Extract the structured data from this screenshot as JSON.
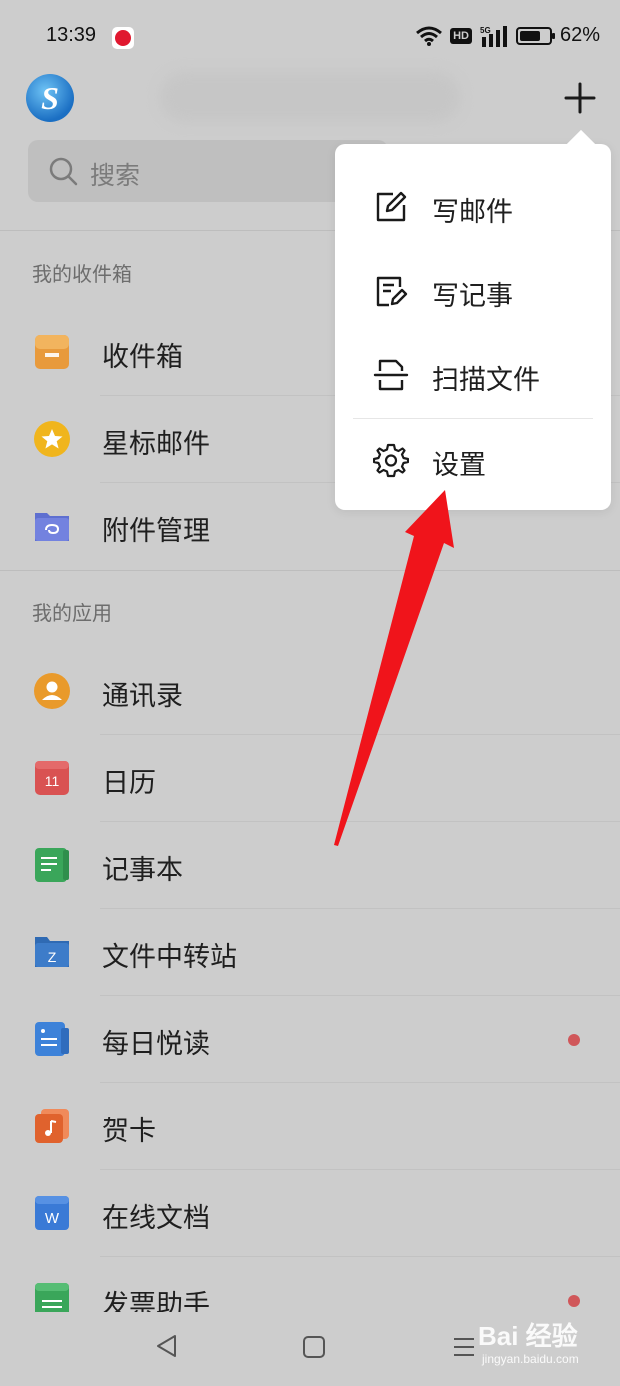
{
  "status_bar": {
    "time": "13:39",
    "hd_label": "HD",
    "network_label": "5G",
    "battery_percent": "62%",
    "battery_level": 0.62
  },
  "header": {
    "logo_letter": "S",
    "search_placeholder": "搜索"
  },
  "sections": {
    "mailbox_title": "我的收件箱",
    "apps_title": "我的应用"
  },
  "mailbox_items": [
    {
      "label": "收件箱",
      "icon": "inbox-tray-icon",
      "color": "#e89a3c"
    },
    {
      "label": "星标邮件",
      "icon": "star-icon",
      "color": "#f0b51d"
    },
    {
      "label": "附件管理",
      "icon": "attachment-folder-icon",
      "color": "#5e6fd0"
    }
  ],
  "app_items": [
    {
      "label": "通讯录",
      "icon": "contacts-icon",
      "color": "#e99a2b",
      "badge": false
    },
    {
      "label": "日历",
      "icon": "calendar-icon",
      "color": "#d95252",
      "day": "11",
      "badge": false
    },
    {
      "label": "记事本",
      "icon": "notebook-icon",
      "color": "#3aa65a",
      "badge": false
    },
    {
      "label": "文件中转站",
      "icon": "file-transfer-icon",
      "color": "#3d7cc9",
      "letter": "Z",
      "badge": false
    },
    {
      "label": "每日悦读",
      "icon": "daily-reading-icon",
      "color": "#3d82d9",
      "badge": true
    },
    {
      "label": "贺卡",
      "icon": "greeting-card-icon",
      "color": "#e0622d",
      "badge": false
    },
    {
      "label": "在线文档",
      "icon": "online-docs-icon",
      "color": "#3a7ad6",
      "letter": "W",
      "badge": false
    },
    {
      "label": "发票助手",
      "icon": "invoice-icon",
      "color": "#3aa65a",
      "badge": true
    }
  ],
  "menu": {
    "items": [
      {
        "label": "写邮件",
        "icon": "compose-mail-icon"
      },
      {
        "label": "写记事",
        "icon": "write-note-icon"
      },
      {
        "label": "扫描文件",
        "icon": "scan-document-icon"
      },
      {
        "label": "设置",
        "icon": "gear-icon"
      }
    ]
  },
  "watermark": {
    "main": "Bai 经验",
    "sub": "jingyan.baidu.com"
  }
}
